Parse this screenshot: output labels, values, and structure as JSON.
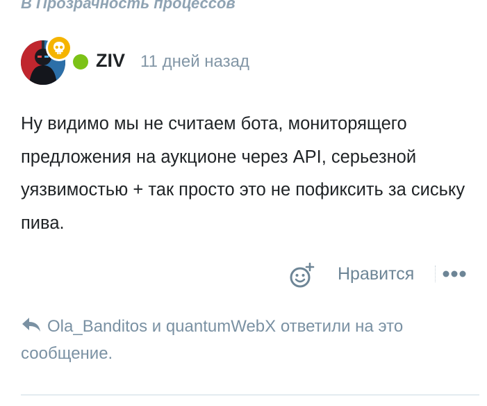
{
  "breadcrumb": {
    "text": "В Прозрачность процессов"
  },
  "post": {
    "author": "ZIV",
    "time": "11 дней назад",
    "body": "Ну видимо мы не считаем бота, мониторящего предложения на аукционе через API, серьезной уязвимостью + так просто это не пофиксить за сиську пива.",
    "avatar_icon": "skull-icon",
    "online_status_color": "#7cc217"
  },
  "actions": {
    "react_icon": "add-reaction-icon",
    "like_label": "Нравится",
    "more_icon": "more-icon"
  },
  "replies": {
    "text": "Ola_Banditos и quantumWebX ответили на это сообщение.",
    "icon": "reply-icon"
  },
  "colors": {
    "accent_muted": "#7a91a3",
    "text": "#1f2326",
    "badge": "#f5b400"
  }
}
